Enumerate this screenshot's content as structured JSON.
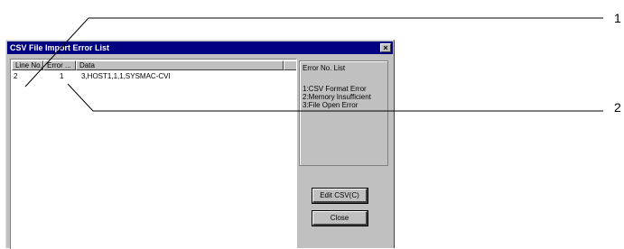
{
  "dialog": {
    "title": "CSV File Import Error List",
    "close_glyph": "×"
  },
  "list": {
    "columns": [
      "Line No.",
      "Error ...",
      "Data"
    ],
    "rows": [
      {
        "line": "2",
        "error": "1",
        "data": "3,HOST1,1,1,SYSMAC-CVI"
      }
    ]
  },
  "error_panel": {
    "title": "Error No. List",
    "items": [
      "1:CSV Format Error",
      "2:Memory Insufficient",
      "3:File Open Error"
    ]
  },
  "buttons": {
    "edit_csv": "Edit CSV(C)",
    "close": "Close"
  },
  "callouts": [
    "1",
    "2"
  ]
}
